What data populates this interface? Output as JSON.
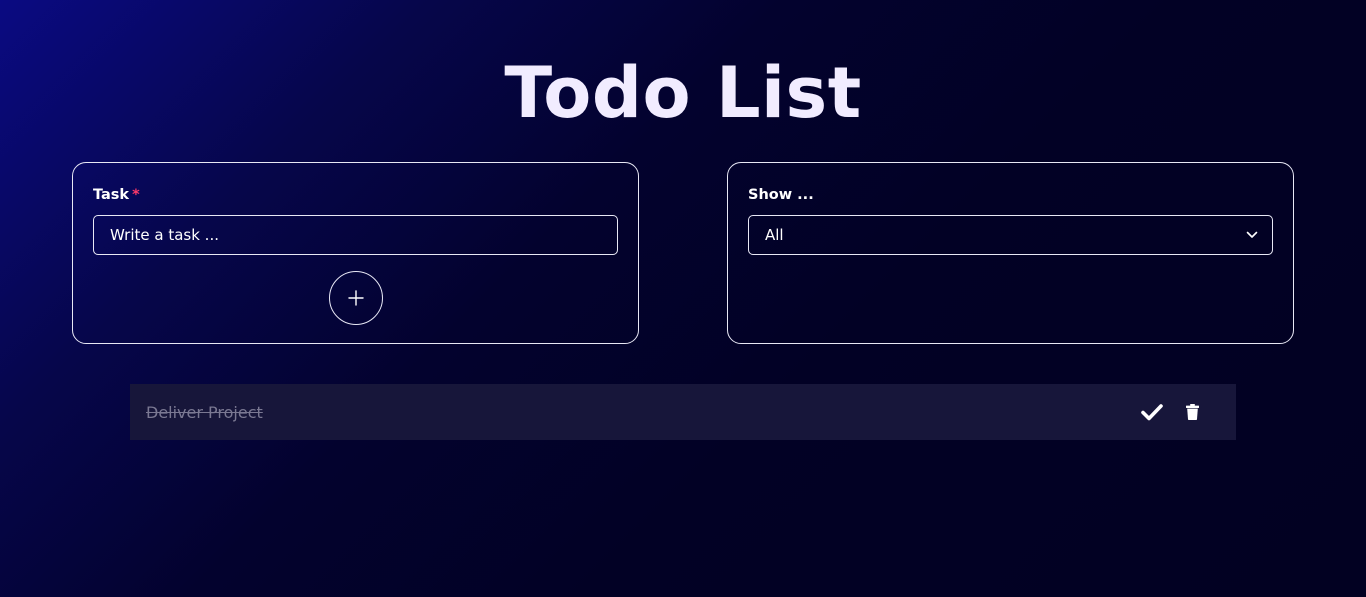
{
  "header": {
    "title": "Todo List"
  },
  "task_card": {
    "label": "Task",
    "required_mark": "*",
    "input_placeholder": "Write a task ...",
    "add_icon": "plus-icon"
  },
  "filter_card": {
    "label": "Show ...",
    "selected": "All",
    "dropdown_icon": "chevron-down-icon"
  },
  "todos": [
    {
      "text": "Deliver Project",
      "completed": true,
      "actions": [
        "check-icon",
        "trash-icon"
      ]
    }
  ],
  "colors": {
    "accent_required": "#ff3a6a",
    "row_bg": "#17163a",
    "completed_text": "#7a7892"
  }
}
